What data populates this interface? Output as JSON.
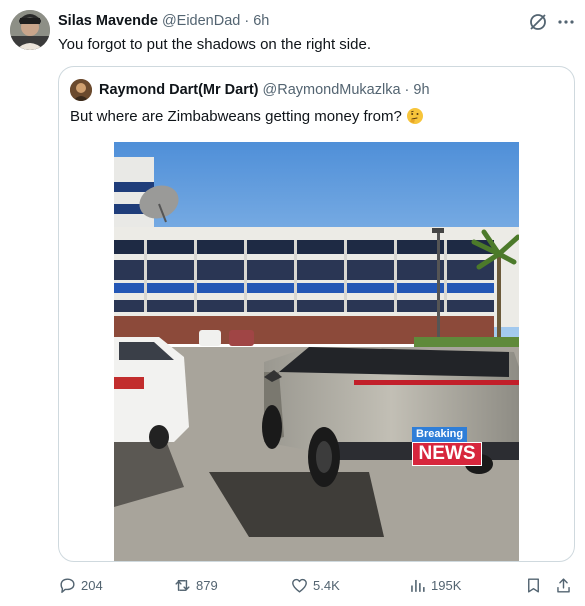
{
  "tweet": {
    "author_name": "Silas Mavende",
    "author_handle": "@EidenDad",
    "separator": "·",
    "time": "6h",
    "text": "You forgot to put the shadows on the right side."
  },
  "quoted_tweet": {
    "author_name": "Raymond Dart(Mr Dart)",
    "author_handle": "@RaymondMukazlka",
    "separator": "·",
    "time": "9h",
    "text": "But where are Zimbabweans getting money from?",
    "emoji": "thinking-face",
    "image": {
      "overlay_label_top": "Breaking",
      "overlay_label_bottom": "NEWS"
    }
  },
  "actions": {
    "replies": "204",
    "reposts": "879",
    "likes": "5.4K",
    "views": "195K"
  },
  "colors": {
    "text_primary": "#0f1419",
    "text_secondary": "#536471",
    "border": "#cfd9de",
    "news_red": "#d7263d",
    "news_blue": "#2f7ed8"
  }
}
